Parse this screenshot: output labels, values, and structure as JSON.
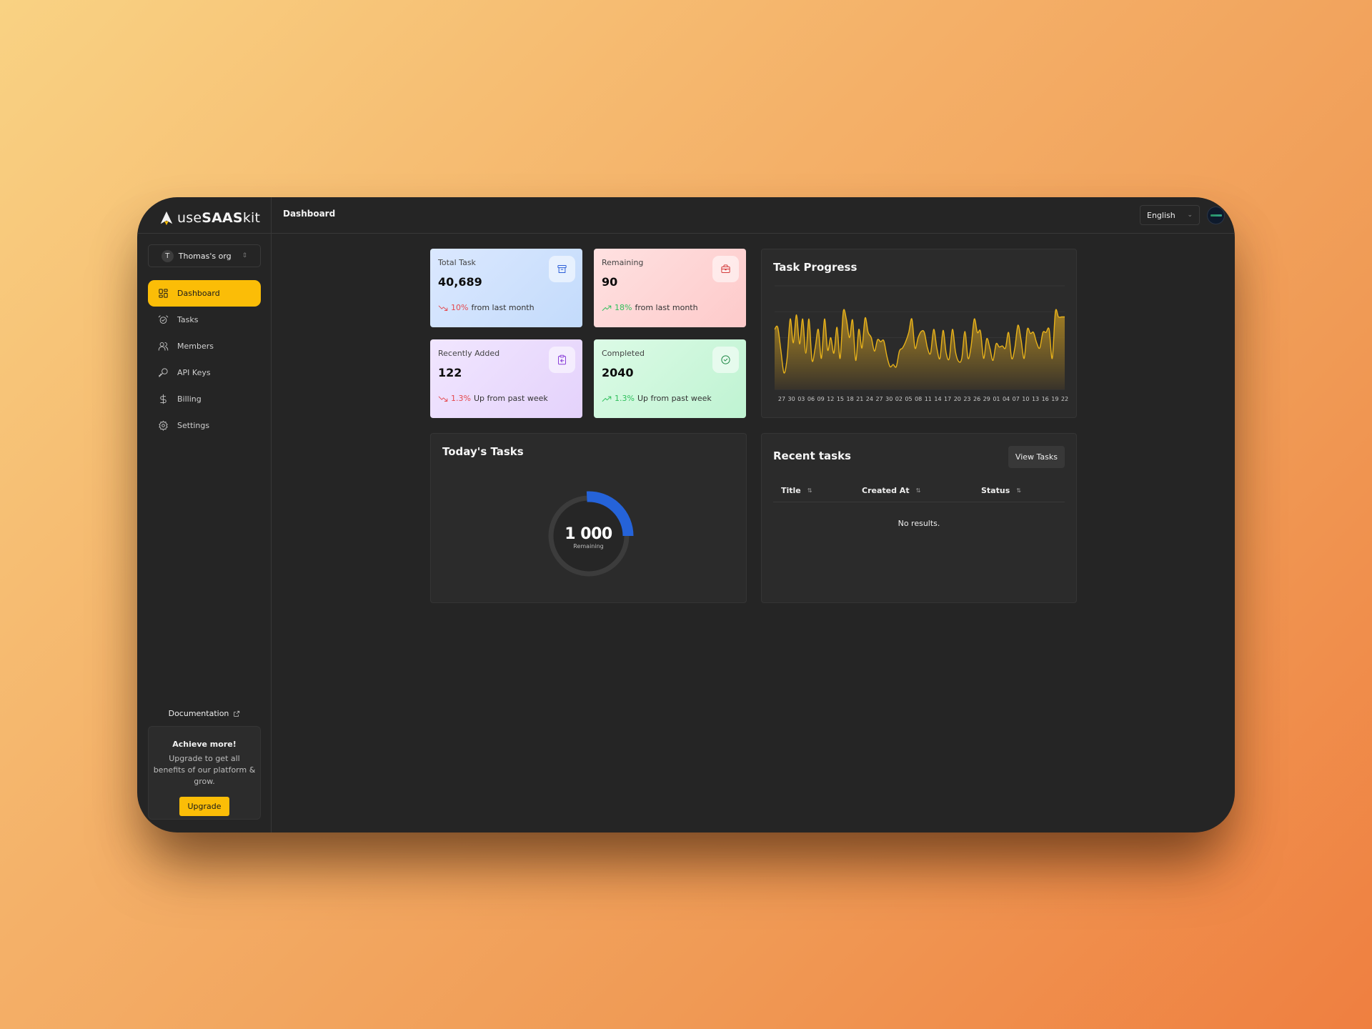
{
  "app": {
    "logo_prefix": "use",
    "logo_bold": "SAAS",
    "logo_suffix": "kit",
    "page_title": "Dashboard",
    "language": "English",
    "org": {
      "initial": "T",
      "name": "Thomas's org"
    }
  },
  "sidebar": {
    "items": [
      {
        "label": "Dashboard",
        "icon": "dashboard-icon",
        "active": true
      },
      {
        "label": "Tasks",
        "icon": "alarm-clock-icon",
        "active": false
      },
      {
        "label": "Members",
        "icon": "users-icon",
        "active": false
      },
      {
        "label": "API Keys",
        "icon": "key-icon",
        "active": false
      },
      {
        "label": "Billing",
        "icon": "dollar-icon",
        "active": false
      },
      {
        "label": "Settings",
        "icon": "gear-icon",
        "active": false
      }
    ],
    "documentation": "Documentation",
    "promo": {
      "title": "Achieve more!",
      "text": "Upgrade to get all benefits of our platform & grow.",
      "button": "Upgrade"
    }
  },
  "stats": [
    {
      "label": "Total Task",
      "value": "40,689",
      "change": "10%",
      "direction": "down",
      "suffix": "from last month",
      "icon": "archive-icon"
    },
    {
      "label": "Remaining",
      "value": "90",
      "change": "18%",
      "direction": "up",
      "suffix": "from last month",
      "icon": "briefcase-icon"
    },
    {
      "label": "Recently Added",
      "value": "122",
      "change": "1.3%",
      "direction": "down",
      "suffix": "Up from past week",
      "icon": "clipboard-icon"
    },
    {
      "label": "Completed",
      "value": "2040",
      "change": "1.3%",
      "direction": "up",
      "suffix": "Up from past week",
      "icon": "check-circle-icon"
    }
  ],
  "colors": {
    "accent": "#fbbd07",
    "chart_line": "#e8b21a",
    "donut_arc": "#2563d9",
    "trend_up": "#2fbf5b",
    "trend_down": "#e5484d"
  },
  "task_progress": {
    "title": "Task Progress"
  },
  "today": {
    "title": "Today's Tasks",
    "value": "1 000",
    "sub": "Remaining",
    "completed_fraction": 0.25
  },
  "recent": {
    "title": "Recent tasks",
    "button": "View Tasks",
    "columns": [
      "Title",
      "Created At",
      "Status"
    ],
    "empty": "No results."
  },
  "chart_data": {
    "type": "area",
    "title": "Task Progress",
    "xlabel": "",
    "ylabel": "",
    "ylim": [
      0,
      100
    ],
    "grid": true,
    "tick_labels": [
      "27",
      "30",
      "03",
      "06",
      "09",
      "12",
      "15",
      "18",
      "21",
      "24",
      "27",
      "30",
      "02",
      "05",
      "08",
      "11",
      "14",
      "17",
      "20",
      "23",
      "26",
      "29",
      "01",
      "04",
      "07",
      "10",
      "13",
      "16",
      "19",
      "22"
    ],
    "values": [
      58,
      60,
      38,
      16,
      30,
      68,
      45,
      72,
      44,
      68,
      35,
      68,
      28,
      40,
      58,
      30,
      68,
      38,
      50,
      35,
      60,
      30,
      75,
      68,
      50,
      67,
      28,
      58,
      40,
      69,
      55,
      50,
      37,
      48,
      46,
      47,
      32,
      22,
      24,
      22,
      37,
      40,
      46,
      55,
      68,
      40,
      50,
      56,
      55,
      40,
      35,
      58,
      40,
      30,
      57,
      35,
      30,
      58,
      36,
      27,
      30,
      56,
      30,
      42,
      68,
      55,
      56,
      30,
      49,
      40,
      28,
      44,
      41,
      42,
      40,
      55,
      30,
      40,
      62,
      48,
      30,
      58,
      54,
      55,
      45,
      40,
      55,
      55,
      58,
      30,
      75,
      70,
      70,
      70
    ]
  }
}
